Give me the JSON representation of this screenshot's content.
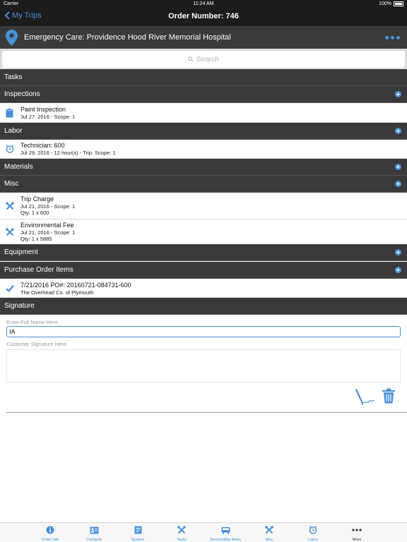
{
  "status_bar": {
    "carrier": "Carrier",
    "time": "11:24 AM",
    "battery": "100%"
  },
  "nav": {
    "back_label": "My Trips",
    "title": "Order Number: 746"
  },
  "hospital": {
    "name": "Emergency Care: Providence Hood River Memorial Hospital"
  },
  "search": {
    "placeholder": "Search"
  },
  "sections": {
    "tasks": "Tasks",
    "inspections": "Inspections",
    "labor": "Labor",
    "materials": "Materials",
    "misc": "Misc",
    "equipment": "Equipment",
    "purchase_order_items": "Purchase Order Items",
    "signature": "Signature"
  },
  "inspections_items": [
    {
      "title": "Paint Inspection",
      "line2": "Jul 27, 2016 - Scope: 1"
    }
  ],
  "labor_items": [
    {
      "title": "Technician: 600",
      "line2": "Jul 29, 2016 - 12 hour(s) - Trip: Scope: 1"
    }
  ],
  "misc_items": [
    {
      "title": "Trip Charge",
      "line2": "Jul 21, 2016 - Scope: 1",
      "line3": "Qty: 1 x 600"
    },
    {
      "title": "Environmental Fee",
      "line2": "Jul 21, 2016 - Scope: 1",
      "line3": "Qty: 1 x 5885"
    }
  ],
  "purchase_order_items": [
    {
      "title": "7/21/2016 PO#: 20160721-084731-600",
      "line2": "The Overhead Co. of Plymouth"
    }
  ],
  "signature": {
    "name_label": "Enter Full Name Here",
    "name_value": "IA",
    "signature_label": "Customer Signature Here"
  },
  "tab_bar": {
    "tabs": [
      {
        "label": "Order Info",
        "icon": "info-icon"
      },
      {
        "label": "Contacts",
        "icon": "contacts-icon"
      },
      {
        "label": "Scopes",
        "icon": "scopes-icon"
      },
      {
        "label": "Tasks",
        "icon": "tools-icon"
      },
      {
        "label": "Serviceable-Items",
        "icon": "truck-icon"
      },
      {
        "label": "Misc",
        "icon": "tools-icon"
      },
      {
        "label": "Labor",
        "icon": "clock-icon"
      },
      {
        "label": "More",
        "icon": "more-dots-icon"
      }
    ]
  },
  "colors": {
    "accent": "#4a90d9",
    "header_dark": "#1c1c1c",
    "section_dark": "#3a3a3a"
  }
}
